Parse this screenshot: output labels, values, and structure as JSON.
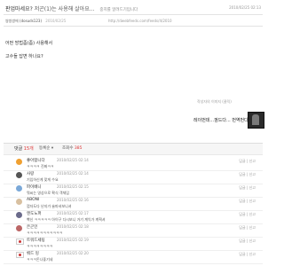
{
  "post": {
    "title_prefix": "판업마세요?",
    "title_main": "저곤(1)는 사용해 살아요...",
    "title_sub": "중치를 알려드기입니다",
    "date": "2010/02/25 02:13",
    "author_name": "쌍쌍쌍에",
    "author_id": "(dosuds123)",
    "author_meta": "2010/02/25",
    "url": "http://dwebfeeds.com/feeds/4/2010",
    "line1": "어떤 방법좀(좀) 사용해서",
    "line2": "고수들 답변 하나요?",
    "image_caption": "작성자의 이미지 (클릭)",
    "quote": "레이번데...껌드다... 번역번다...",
    "quote_bubble": "레이번데...껌드다... 번역번다..."
  },
  "comments_header": {
    "label": "댓글",
    "count": "15개",
    "sort": "등록순 ▾",
    "views_label": "조회수",
    "views": "385"
  },
  "comments": [
    {
      "nick": "좋아합니다",
      "date": "2010/02/25 02:14",
      "text": "ㅋㅋㅋㅋ 진짜ㅋㅋ",
      "avatar": "#f0a030",
      "flag": false
    },
    {
      "nick": "사랑",
      "date": "2010/02/25 02:14",
      "text": "기입하신게 맞게 수요",
      "avatar": "#555555",
      "flag": false
    },
    {
      "nick": "파이베니",
      "date": "2010/02/25 02:15",
      "text": "뭐씨는 영상으로 확식 객체입",
      "avatar": "#7aa8d8",
      "flag": false
    },
    {
      "nick": "ABONI",
      "date": "2010/02/25 02:16",
      "text": "껌자도다 난지가 술마셔보니셔",
      "avatar": "#d8c0a0",
      "flag": false
    },
    {
      "nick": "엔도노퍼",
      "date": "2010/02/25 02:17",
      "text": "빡신 ㅋㅋㅋㅋㅋ 아이구 다시보니 거기 계익가 계획셔",
      "avatar": "#6a6a8a",
      "flag": false
    },
    {
      "nick": "은곤인",
      "date": "2010/02/25 02:18",
      "text": "ㅋㅋㅋㅋㅋㅋㅋㅋㅋㅋㅋ",
      "avatar": "#bb6666",
      "flag": false
    },
    {
      "nick": "트워드세팅",
      "date": "2010/02/25 02:19",
      "text": "ㅋㅋㅋㅋㅋㅋㅋㅋ",
      "avatar": "#ffffff",
      "flag": true
    },
    {
      "nick": "뤄드 밍",
      "date": "2010/02/25 02:20",
      "text": "ㅋㅋㅋ돈나좋기네",
      "avatar": "#ffffff",
      "flag": true
    }
  ],
  "actions": {
    "reply": "답글",
    "delete": "신고"
  }
}
